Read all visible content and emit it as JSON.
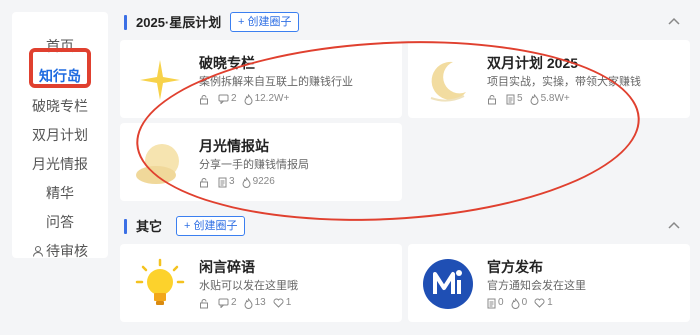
{
  "sidebar": {
    "items": [
      {
        "label": "首页"
      },
      {
        "label": "知行岛"
      },
      {
        "label": "破晓专栏"
      },
      {
        "label": "双月计划"
      },
      {
        "label": "月光情报"
      },
      {
        "label": "精华"
      },
      {
        "label": "问答"
      },
      {
        "label": "待审核"
      }
    ],
    "active_index": 1
  },
  "sections": [
    {
      "title": "2025·星辰计划",
      "create_label": "+ 创建圈子",
      "cards": [
        {
          "title": "破晓专栏",
          "desc": "案例拆解来自互联上的赚钱行业",
          "comments": "2",
          "heat": "12.2W+",
          "icon": "star-icon"
        },
        {
          "title": "双月计划 2025",
          "desc": "项目实战，实操，带领大家赚钱",
          "docs": "5",
          "heat": "5.8W+",
          "icon": "moon-icon"
        },
        {
          "title": "月光情报站",
          "desc": "分享一手的赚钱情报局",
          "docs": "3",
          "heat": "9226",
          "icon": "moon-cloud-icon"
        }
      ]
    },
    {
      "title": "其它",
      "create_label": "+ 创建圈子",
      "cards": [
        {
          "title": "闲言碎语",
          "desc": "水贴可以发在这里哦",
          "comments": "2",
          "heat": "13",
          "likes": "1",
          "icon": "lightbulb-icon"
        },
        {
          "title": "官方发布",
          "desc": "官方通知会发在这里",
          "docs": "0",
          "heat": "0",
          "likes": "1",
          "icon": "brand-logo-icon"
        }
      ]
    }
  ],
  "colors": {
    "accent": "#3b6fe5",
    "annotation": "#e0402f"
  }
}
